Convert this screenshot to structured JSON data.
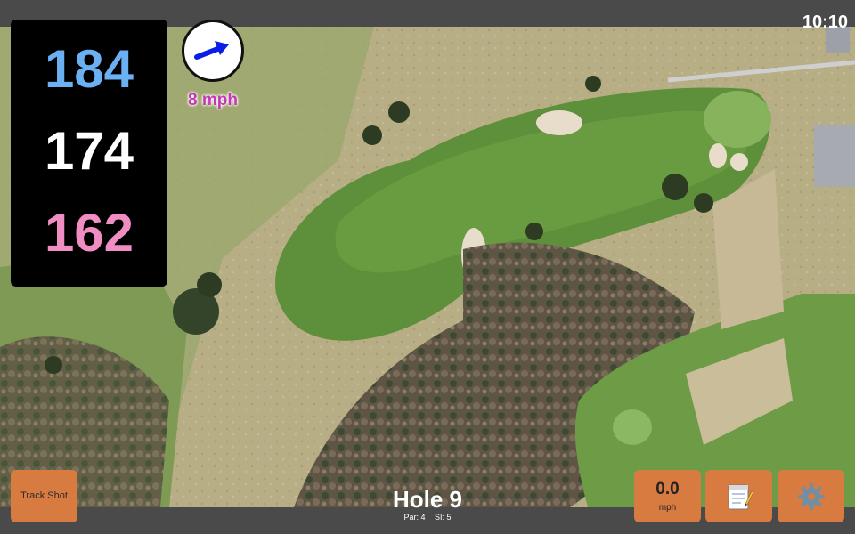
{
  "status_bar": {
    "time": "10:10"
  },
  "distances": {
    "back": "184",
    "center": "174",
    "front": "162"
  },
  "wind": {
    "speed_label": "8 mph",
    "icon": "wind-arrow-icon",
    "arrow_color": "#0a1ee6"
  },
  "track_shot": {
    "label": "Track Shot"
  },
  "hole": {
    "title": "Hole 9",
    "par": "Par: 4",
    "si": "SI: 5"
  },
  "speed": {
    "value": "0.0",
    "unit": "mph"
  },
  "notes": {
    "icon": "notepad-icon"
  },
  "settings": {
    "icon": "gear-icon"
  },
  "colors": {
    "button_orange": "#d87b41",
    "back_distance": "#6ab0f2",
    "center_distance": "#ffffff",
    "front_distance": "#f08ec4",
    "wind_text": "#c23ab4"
  }
}
